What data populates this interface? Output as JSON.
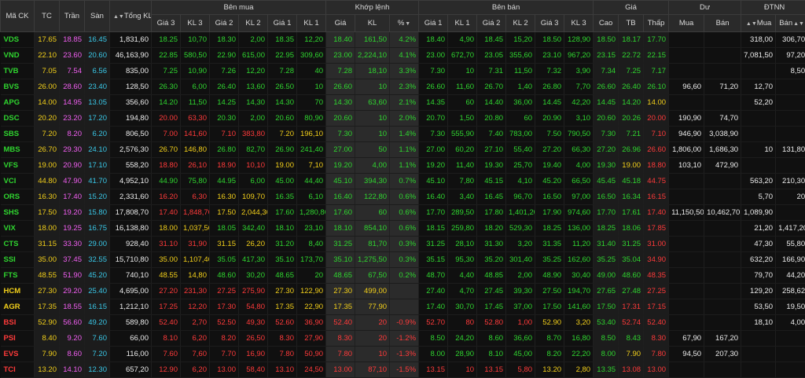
{
  "headers": {
    "symbol": "Mã CK",
    "ref": "TC",
    "ceil": "Trần",
    "floor": "Sàn",
    "total_vol": "Tổng KL",
    "buy_group": "Bên mua",
    "match_group": "Khớp lệnh",
    "sell_group": "Bên bán",
    "price_group": "Giá",
    "remain_group": "Dư",
    "foreign_group": "ĐTNN",
    "price3": "Giá 3",
    "vol3": "KL 3",
    "price2": "Giá 2",
    "vol2": "KL 2",
    "price1": "Giá 1",
    "vol1": "KL 1",
    "match_price": "Giá",
    "match_vol": "KL",
    "percent": "%",
    "high": "Cao",
    "avg": "TB",
    "low": "Thấp",
    "remain_buy": "Mua",
    "remain_sell": "Bán",
    "foreign_buy": "Mua",
    "foreign_sell": "Bán",
    "sort_icon": "▲▼"
  },
  "colors": {
    "up": "#2fd52f",
    "down": "#ff3a3a",
    "reference": "#f2cf1a",
    "ceiling": "#f25ff2",
    "floor": "#39c8e8",
    "neutral": "#ececec"
  },
  "rows": [
    {
      "sym": "VDS",
      "tc": "17.65",
      "tran": "18.85",
      "san": "16.45",
      "tkl": "1,831,60",
      "bp3": "18.25",
      "bv3": "10,70",
      "bp2": "18.30",
      "bv2": "2,00",
      "bp1": "18.35",
      "bv1": "12,20",
      "mp": "18.40",
      "mv": "161,50",
      "pct": "4.2%",
      "sp1": "18.40",
      "sv1": "4,90",
      "sp2": "18.45",
      "sv2": "15,20",
      "sp3": "18.50",
      "sv3": "128,90",
      "hi": "18.50",
      "avg": "18.17",
      "lo": "17.70",
      "rb": "",
      "rs": "",
      "fb": "318,00",
      "fs": "306,70"
    },
    {
      "sym": "VND",
      "tc": "22.10",
      "tran": "23.60",
      "san": "20.60",
      "tkl": "46,163,90",
      "bp3": "22.85",
      "bv3": "580,50",
      "bp2": "22.90",
      "bv2": "615,00",
      "bp1": "22.95",
      "bv1": "309,60",
      "mp": "23.00",
      "mv": "2,224,10",
      "pct": "4.1%",
      "sp1": "23.00",
      "sv1": "672,70",
      "sp2": "23.05",
      "sv2": "355,60",
      "sp3": "23.10",
      "sv3": "967,20",
      "hi": "23.15",
      "avg": "22.72",
      "lo": "22.15",
      "rb": "",
      "rs": "",
      "fb": "7,081,50",
      "fs": "97,20"
    },
    {
      "sym": "TVB",
      "tc": "7.05",
      "tran": "7.54",
      "san": "6.56",
      "tkl": "835,00",
      "bp3": "7.25",
      "bv3": "10,90",
      "bp2": "7.26",
      "bv2": "12,20",
      "bp1": "7.28",
      "bv1": "40",
      "mp": "7.28",
      "mv": "18,10",
      "pct": "3.3%",
      "sp1": "7.30",
      "sv1": "10",
      "sp2": "7.31",
      "sv2": "11,50",
      "sp3": "7.32",
      "sv3": "3,90",
      "hi": "7.34",
      "avg": "7.25",
      "lo": "7.17",
      "rb": "",
      "rs": "",
      "fb": "",
      "fs": "8,50"
    },
    {
      "sym": "BVS",
      "tc": "26.00",
      "tran": "28.60",
      "san": "23.40",
      "tkl": "128,50",
      "bp3": "26.30",
      "bv3": "6,00",
      "bp2": "26.40",
      "bv2": "13,60",
      "bp1": "26.50",
      "bv1": "10",
      "mp": "26.60",
      "mv": "10",
      "pct": "2.3%",
      "sp1": "26.60",
      "sv1": "11,60",
      "sp2": "26.70",
      "sv2": "1,40",
      "sp3": "26.80",
      "sv3": "7,70",
      "hi": "26.60",
      "avg": "26.40",
      "lo": "26.10",
      "rb": "96,60",
      "rs": "71,20",
      "fb": "12,70",
      "fs": ""
    },
    {
      "sym": "APG",
      "tc": "14.00",
      "tran": "14.95",
      "san": "13.05",
      "tkl": "356,60",
      "bp3": "14.20",
      "bv3": "11,50",
      "bp2": "14.25",
      "bv2": "14,30",
      "bp1": "14.30",
      "bv1": "70",
      "mp": "14.30",
      "mv": "63,60",
      "pct": "2.1%",
      "sp1": "14.35",
      "sv1": "60",
      "sp2": "14.40",
      "sv2": "36,00",
      "sp3": "14.45",
      "sv3": "42,20",
      "hi": "14.45",
      "avg": "14.20",
      "lo": "14.00",
      "rb": "",
      "rs": "",
      "fb": "52,20",
      "fs": ""
    },
    {
      "sym": "DSC",
      "tc": "20.20",
      "tran": "23.20",
      "san": "17.20",
      "tkl": "194,80",
      "bp3": "20.00",
      "bv3": "63,30",
      "bp2": "20.30",
      "bv2": "2,00",
      "bp1": "20.60",
      "bv1": "80,90",
      "mp": "20.60",
      "mv": "10",
      "pct": "2.0%",
      "sp1": "20.70",
      "sv1": "1,50",
      "sp2": "20.80",
      "sv2": "60",
      "sp3": "20.90",
      "sv3": "3,10",
      "hi": "20.60",
      "avg": "20.26",
      "lo": "20.00",
      "rb": "190,90",
      "rs": "74,70",
      "fb": "",
      "fs": ""
    },
    {
      "sym": "SBS",
      "tc": "7.20",
      "tran": "8.20",
      "san": "6.20",
      "tkl": "806,50",
      "bp3": "7.00",
      "bv3": "141,60",
      "bp2": "7.10",
      "bv2": "383,80",
      "bp1": "7.20",
      "bv1": "196,10",
      "mp": "7.30",
      "mv": "10",
      "pct": "1.4%",
      "sp1": "7.30",
      "sv1": "555,90",
      "sp2": "7.40",
      "sv2": "783,00",
      "sp3": "7.50",
      "sv3": "790,50",
      "hi": "7.30",
      "avg": "7.21",
      "lo": "7.10",
      "rb": "946,90",
      "rs": "3,038,90",
      "fb": "",
      "fs": ""
    },
    {
      "sym": "MBS",
      "tc": "26.70",
      "tran": "29.30",
      "san": "24.10",
      "tkl": "2,576,30",
      "bp3": "26.70",
      "bv3": "146,80",
      "bp2": "26.80",
      "bv2": "82,70",
      "bp1": "26.90",
      "bv1": "241,40",
      "mp": "27.00",
      "mv": "50",
      "pct": "1.1%",
      "sp1": "27.00",
      "sv1": "60,20",
      "sp2": "27.10",
      "sv2": "55,40",
      "sp3": "27.20",
      "sv3": "66,30",
      "hi": "27.20",
      "avg": "26.96",
      "lo": "26.60",
      "rb": "1,806,00",
      "rs": "1,686,30",
      "fb": "10",
      "fs": "131,80"
    },
    {
      "sym": "VFS",
      "tc": "19.00",
      "tran": "20.90",
      "san": "17.10",
      "tkl": "558,20",
      "bp3": "18.80",
      "bv3": "26,10",
      "bp2": "18.90",
      "bv2": "10,10",
      "bp1": "19.00",
      "bv1": "7,10",
      "mp": "19.20",
      "mv": "4,00",
      "pct": "1.1%",
      "sp1": "19.20",
      "sv1": "11,40",
      "sp2": "19.30",
      "sv2": "25,70",
      "sp3": "19.40",
      "sv3": "4,00",
      "hi": "19.30",
      "avg": "19.00",
      "lo": "18.80",
      "rb": "103,10",
      "rs": "472,90",
      "fb": "",
      "fs": ""
    },
    {
      "sym": "VCI",
      "tc": "44.80",
      "tran": "47.90",
      "san": "41.70",
      "tkl": "4,952,10",
      "bp3": "44.90",
      "bv3": "75,80",
      "bp2": "44.95",
      "bv2": "6,00",
      "bp1": "45.00",
      "bv1": "44,40",
      "mp": "45.10",
      "mv": "394,30",
      "pct": "0.7%",
      "sp1": "45.10",
      "sv1": "7,80",
      "sp2": "45.15",
      "sv2": "4,10",
      "sp3": "45.20",
      "sv3": "66,50",
      "hi": "45.45",
      "avg": "45.18",
      "lo": "44.75",
      "rb": "",
      "rs": "",
      "fb": "563,20",
      "fs": "210,30"
    },
    {
      "sym": "ORS",
      "tc": "16.30",
      "tran": "17.40",
      "san": "15.20",
      "tkl": "2,331,60",
      "bp3": "16.20",
      "bv3": "6,30",
      "bp2": "16.30",
      "bv2": "109,70",
      "bp1": "16.35",
      "bv1": "6,10",
      "mp": "16.40",
      "mv": "122,80",
      "pct": "0.6%",
      "sp1": "16.40",
      "sv1": "3,40",
      "sp2": "16.45",
      "sv2": "96,70",
      "sp3": "16.50",
      "sv3": "97,00",
      "hi": "16.50",
      "avg": "16.34",
      "lo": "16.15",
      "rb": "",
      "rs": "",
      "fb": "5,70",
      "fs": "20"
    },
    {
      "sym": "SHS",
      "tc": "17.50",
      "tran": "19.20",
      "san": "15.80",
      "tkl": "17,808,70",
      "bp3": "17.40",
      "bv3": "1,848,70",
      "bp2": "17.50",
      "bv2": "2,044,30",
      "bp1": "17.60",
      "bv1": "1,280,80",
      "mp": "17.60",
      "mv": "60",
      "pct": "0.6%",
      "sp1": "17.70",
      "sv1": "289,50",
      "sp2": "17.80",
      "sv2": "1,401,20",
      "sp3": "17.90",
      "sv3": "974,60",
      "hi": "17.70",
      "avg": "17.61",
      "lo": "17.40",
      "rb": "11,150,50",
      "rs": "10,462,70",
      "fb": "1,089,90",
      "fs": ""
    },
    {
      "sym": "VIX",
      "tc": "18.00",
      "tran": "19.25",
      "san": "16.75",
      "tkl": "16,138,80",
      "bp3": "18.00",
      "bv3": "1,037,50",
      "bp2": "18.05",
      "bv2": "342,40",
      "bp1": "18.10",
      "bv1": "23,10",
      "mp": "18.10",
      "mv": "854,10",
      "pct": "0.6%",
      "sp1": "18.15",
      "sv1": "259,80",
      "sp2": "18.20",
      "sv2": "529,30",
      "sp3": "18.25",
      "sv3": "136,00",
      "hi": "18.25",
      "avg": "18.06",
      "lo": "17.85",
      "rb": "",
      "rs": "",
      "fb": "21,20",
      "fs": "1,417,20"
    },
    {
      "sym": "CTS",
      "tc": "31.15",
      "tran": "33.30",
      "san": "29.00",
      "tkl": "928,40",
      "bp3": "31.10",
      "bv3": "31,90",
      "bp2": "31.15",
      "bv2": "26,20",
      "bp1": "31.20",
      "bv1": "8,40",
      "mp": "31.25",
      "mv": "81,70",
      "pct": "0.3%",
      "sp1": "31.25",
      "sv1": "28,10",
      "sp2": "31.30",
      "sv2": "3,20",
      "sp3": "31.35",
      "sv3": "11,20",
      "hi": "31.40",
      "avg": "31.25",
      "lo": "31.00",
      "rb": "",
      "rs": "",
      "fb": "47,30",
      "fs": "55,80"
    },
    {
      "sym": "SSI",
      "tc": "35.00",
      "tran": "37.45",
      "san": "32.55",
      "tkl": "15,710,80",
      "bp3": "35.00",
      "bv3": "1,107,40",
      "bp2": "35.05",
      "bv2": "417,30",
      "bp1": "35.10",
      "bv1": "173,70",
      "mp": "35.10",
      "mv": "1,275,50",
      "pct": "0.3%",
      "sp1": "35.15",
      "sv1": "95,30",
      "sp2": "35.20",
      "sv2": "301,40",
      "sp3": "35.25",
      "sv3": "162,60",
      "hi": "35.25",
      "avg": "35.04",
      "lo": "34.90",
      "rb": "",
      "rs": "",
      "fb": "632,20",
      "fs": "166,90"
    },
    {
      "sym": "FTS",
      "tc": "48.55",
      "tran": "51.90",
      "san": "45.20",
      "tkl": "740,10",
      "bp3": "48.55",
      "bv3": "14,80",
      "bp2": "48.60",
      "bv2": "30,20",
      "bp1": "48.65",
      "bv1": "20",
      "mp": "48.65",
      "mv": "67,50",
      "pct": "0.2%",
      "sp1": "48.70",
      "sv1": "4,40",
      "sp2": "48.85",
      "sv2": "2,00",
      "sp3": "48.90",
      "sv3": "30,40",
      "hi": "49.00",
      "avg": "48.60",
      "lo": "48.35",
      "rb": "",
      "rs": "",
      "fb": "79,70",
      "fs": "44,20"
    },
    {
      "sym": "HCM",
      "tc": "27.30",
      "tran": "29.20",
      "san": "25.40",
      "tkl": "4,695,00",
      "bp3": "27.20",
      "bv3": "231,30",
      "bp2": "27.25",
      "bv2": "275,90",
      "bp1": "27.30",
      "bv1": "122,90",
      "mp": "27.30",
      "mv": "499,00",
      "pct": "",
      "sp1": "27.40",
      "sv1": "4,70",
      "sp2": "27.45",
      "sv2": "39,30",
      "sp3": "27.50",
      "sv3": "194,70",
      "hi": "27.65",
      "avg": "27.48",
      "lo": "27.25",
      "rb": "",
      "rs": "",
      "fb": "129,20",
      "fs": "258,62"
    },
    {
      "sym": "AGR",
      "tc": "17.35",
      "tran": "18.55",
      "san": "16.15",
      "tkl": "1,212,10",
      "bp3": "17.25",
      "bv3": "12,20",
      "bp2": "17.30",
      "bv2": "54,80",
      "bp1": "17.35",
      "bv1": "22,90",
      "mp": "17.35",
      "mv": "77,90",
      "pct": "",
      "sp1": "17.40",
      "sv1": "30,70",
      "sp2": "17.45",
      "sv2": "37,00",
      "sp3": "17.50",
      "sv3": "141,60",
      "hi": "17.50",
      "avg": "17.31",
      "lo": "17.15",
      "rb": "",
      "rs": "",
      "fb": "53,50",
      "fs": "19,50"
    },
    {
      "sym": "BSI",
      "tc": "52.90",
      "tran": "56.60",
      "san": "49.20",
      "tkl": "589,80",
      "bp3": "52.40",
      "bv3": "2,70",
      "bp2": "52.50",
      "bv2": "49,30",
      "bp1": "52.60",
      "bv1": "36,90",
      "mp": "52.40",
      "mv": "20",
      "pct": "-0.9%",
      "sp1": "52.70",
      "sv1": "80",
      "sp2": "52.80",
      "sv2": "1,00",
      "sp3": "52.90",
      "sv3": "3,20",
      "hi": "53.40",
      "avg": "52.74",
      "lo": "52.40",
      "rb": "",
      "rs": "",
      "fb": "18,10",
      "fs": "4,00"
    },
    {
      "sym": "PSI",
      "tc": "8.40",
      "tran": "9.20",
      "san": "7.60",
      "tkl": "66,00",
      "bp3": "8.10",
      "bv3": "6,20",
      "bp2": "8.20",
      "bv2": "26,50",
      "bp1": "8.30",
      "bv1": "27,90",
      "mp": "8.30",
      "mv": "20",
      "pct": "-1.2%",
      "sp1": "8.50",
      "sv1": "24,20",
      "sp2": "8.60",
      "sv2": "36,60",
      "sp3": "8.70",
      "sv3": "16,80",
      "hi": "8.50",
      "avg": "8.43",
      "lo": "8.30",
      "rb": "67,90",
      "rs": "167,20",
      "fb": "",
      "fs": ""
    },
    {
      "sym": "EVS",
      "tc": "7.90",
      "tran": "8.60",
      "san": "7.20",
      "tkl": "116,00",
      "bp3": "7.60",
      "bv3": "7,60",
      "bp2": "7.70",
      "bv2": "16,90",
      "bp1": "7.80",
      "bv1": "50,90",
      "mp": "7.80",
      "mv": "10",
      "pct": "-1.3%",
      "sp1": "8.00",
      "sv1": "28,90",
      "sp2": "8.10",
      "sv2": "45,00",
      "sp3": "8.20",
      "sv3": "22,20",
      "hi": "8.00",
      "avg": "7.90",
      "lo": "7.80",
      "rb": "94,50",
      "rs": "207,30",
      "fb": "",
      "fs": ""
    },
    {
      "sym": "TCI",
      "tc": "13.20",
      "tran": "14.10",
      "san": "12.30",
      "tkl": "657,20",
      "bp3": "12.90",
      "bv3": "6,20",
      "bp2": "13.00",
      "bv2": "58,40",
      "bp1": "13.10",
      "bv1": "24,50",
      "mp": "13.00",
      "mv": "87,10",
      "pct": "-1.5%",
      "sp1": "13.15",
      "sv1": "10",
      "sp2": "13.15",
      "sv2": "5,80",
      "sp3": "13.20",
      "sv3": "2,80",
      "hi": "13.35",
      "avg": "13.08",
      "lo": "13.00",
      "rb": "",
      "rs": "",
      "fb": "",
      "fs": ""
    }
  ]
}
